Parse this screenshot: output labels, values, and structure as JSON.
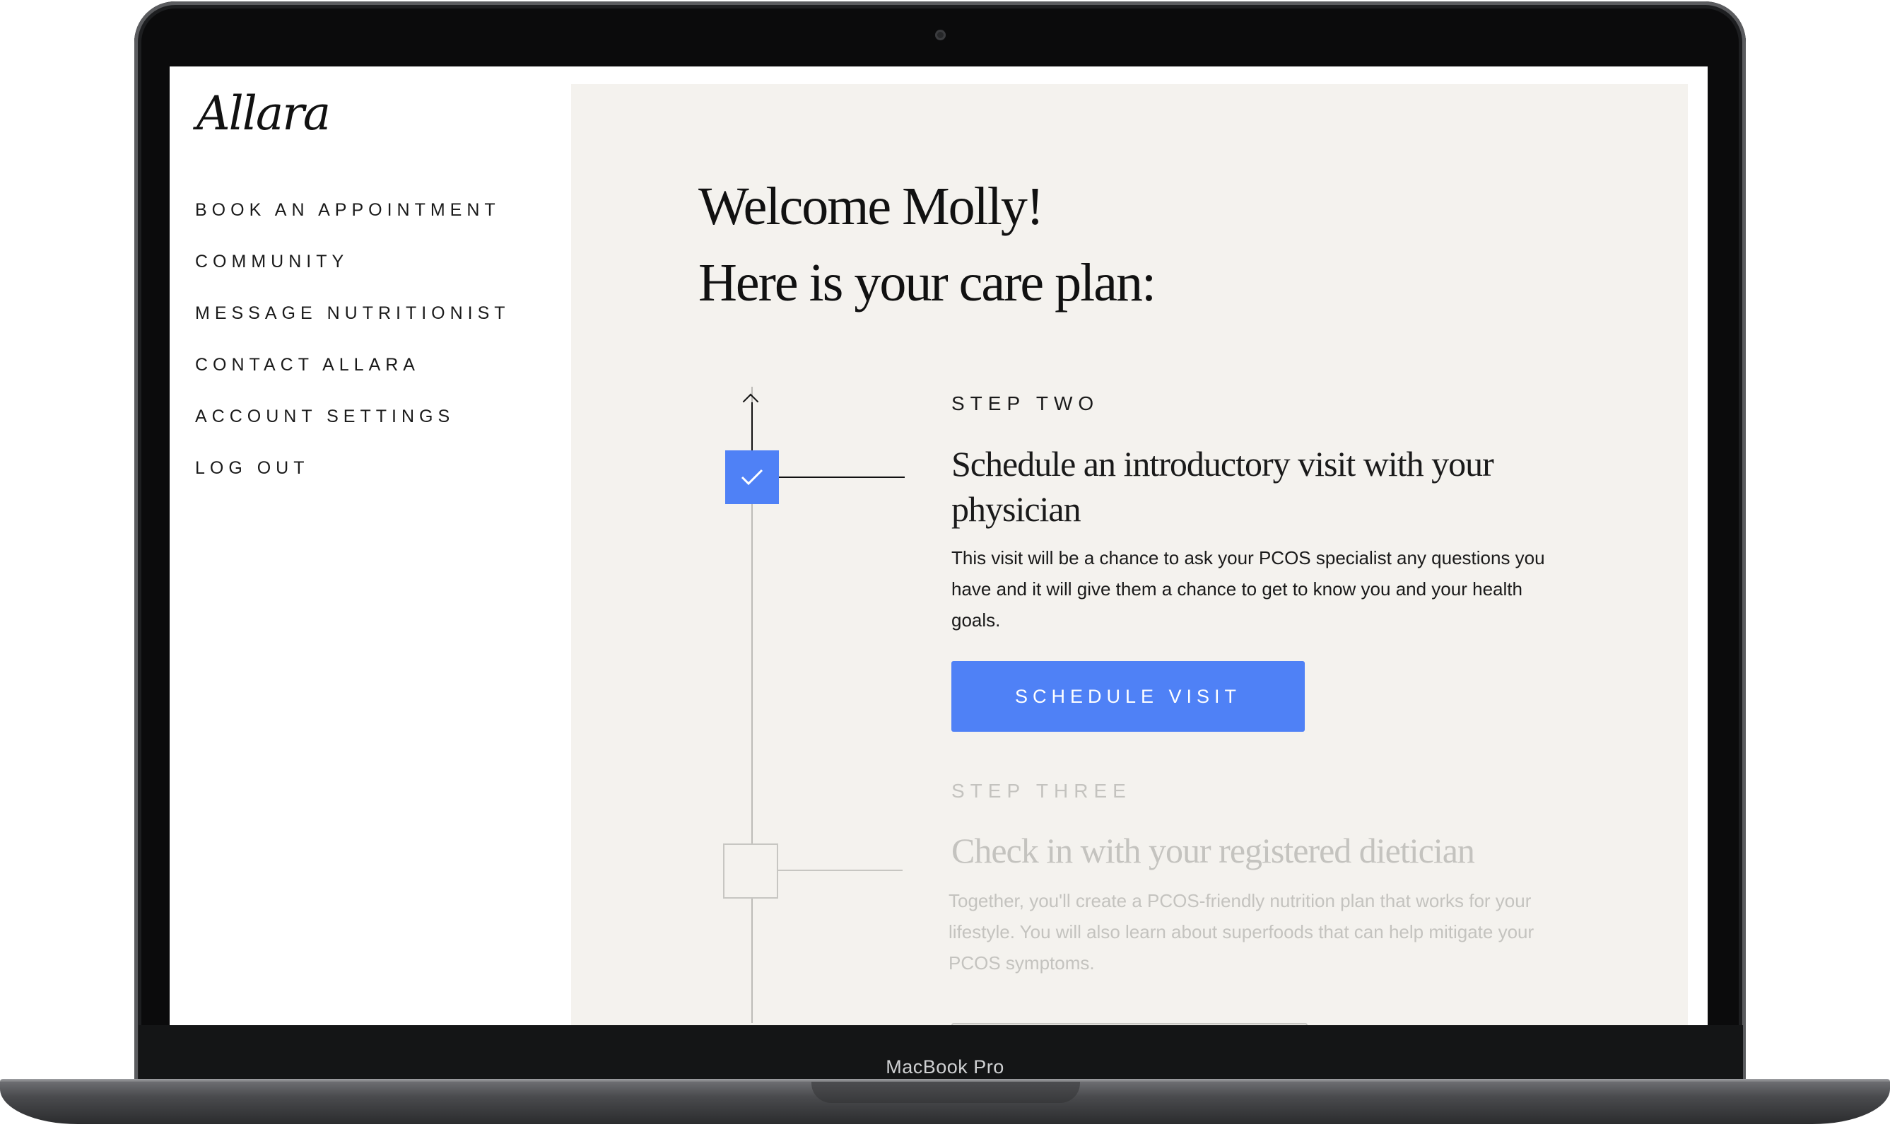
{
  "brand": {
    "logo": "Allara"
  },
  "sidebar": {
    "items": [
      {
        "label": "BOOK AN APPOINTMENT"
      },
      {
        "label": "COMMUNITY"
      },
      {
        "label": "MESSAGE NUTRITIONIST"
      },
      {
        "label": "CONTACT ALLARA"
      },
      {
        "label": "ACCOUNT SETTINGS"
      },
      {
        "label": "LOG OUT"
      }
    ]
  },
  "main": {
    "greeting": "Welcome Molly!",
    "subheading": "Here is your care plan:",
    "steps": [
      {
        "label": "STEP TWO",
        "title": "Schedule an introductory visit with your physician",
        "description": "This visit will be a chance to ask your PCOS specialist any questions you have and it will give them  a chance to get to know you and your health goals.",
        "button": "SCHEDULE VISIT",
        "status": "completed"
      },
      {
        "label": "STEP THREE",
        "title": "Check in with  your registered dietician",
        "description": "Together, you'll create a PCOS-friendly nutrition plan that works for your lifestyle. You will also learn about superfoods that can help mitigate your PCOS symptoms.",
        "status": "pending"
      }
    ]
  },
  "device": {
    "label": "MacBook Pro"
  },
  "colors": {
    "accent": "#4f81f6",
    "panel": "#f4f2ee",
    "muted": "#c4c3bf"
  },
  "icons": {
    "step_done": "checkmark-icon",
    "timeline": "arrow-up-icon"
  }
}
